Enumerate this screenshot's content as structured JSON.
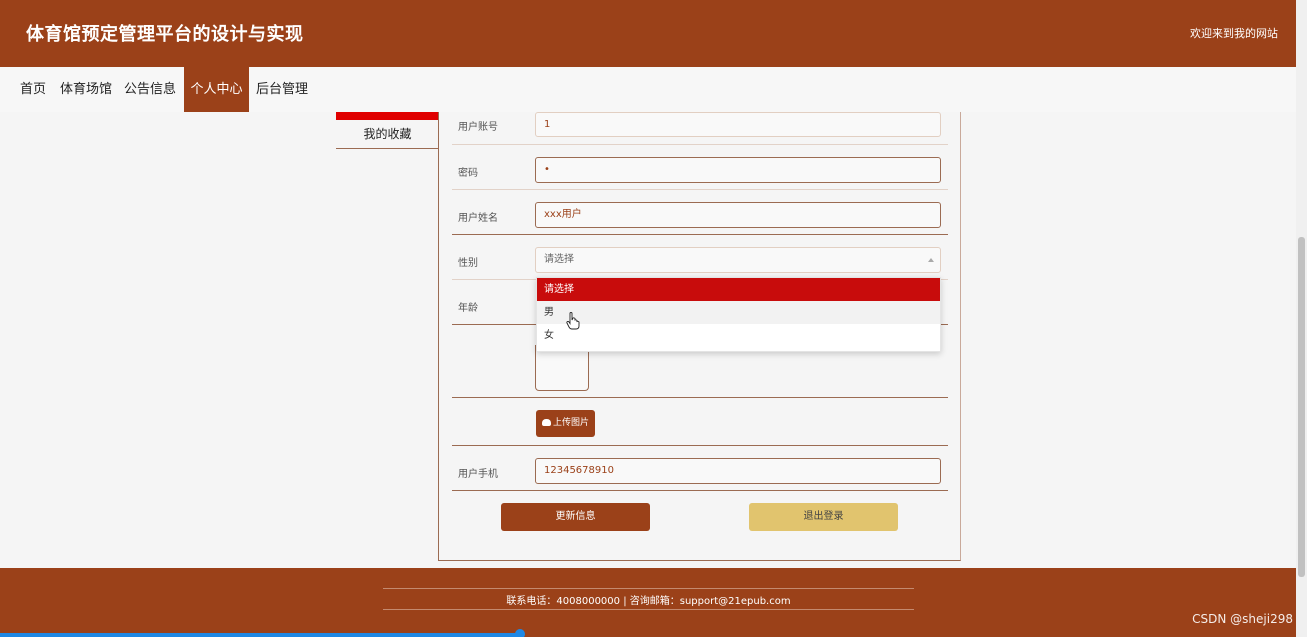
{
  "header": {
    "site_title": "体育馆预定管理平台的设计与实现",
    "welcome": "欢迎来到我的网站"
  },
  "nav": {
    "items": [
      "首页",
      "体育场馆",
      "公告信息",
      "个人中心",
      "后台管理"
    ],
    "active": "个人中心"
  },
  "sidebar": {
    "items": [
      "我的收藏"
    ]
  },
  "form": {
    "account_label": "用户账号",
    "account_value": "1",
    "password_label": "密码",
    "password_value": "•",
    "name_label": "用户姓名",
    "name_value": "xxx用户",
    "gender_label": "性别",
    "gender_placeholder": "请选择",
    "gender_options": [
      "请选择",
      "男",
      "女"
    ],
    "gender_highlighted": "请选择",
    "age_label": "年龄",
    "upload_label": "上传图片",
    "phone_label": "用户手机",
    "phone_value": "12345678910",
    "update_button": "更新信息",
    "logout_button": "退出登录"
  },
  "footer": {
    "contact": "联系电话：4008000000 | 咨询邮箱：support@21epub.com"
  },
  "watermark": "CSDN @sheji298",
  "colors": {
    "brand": "#9b4119",
    "highlight": "#c80c0c",
    "logout": "#e1c46e"
  }
}
